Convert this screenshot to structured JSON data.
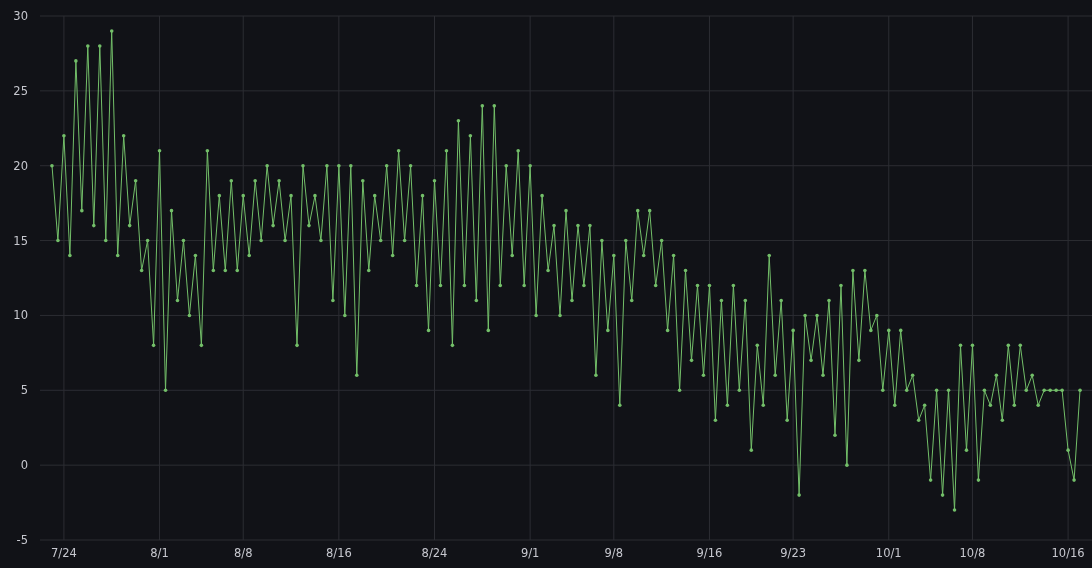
{
  "chart_data": {
    "type": "line",
    "grid": true,
    "ylim": [
      -5,
      30
    ],
    "yticks": [
      -5,
      0,
      5,
      10,
      15,
      20,
      25,
      30
    ],
    "categories": [
      null,
      null,
      "7/24",
      null,
      null,
      null,
      null,
      null,
      null,
      null,
      null,
      null,
      null,
      null,
      null,
      null,
      null,
      null,
      "8/1",
      null,
      null,
      null,
      null,
      null,
      null,
      null,
      null,
      null,
      null,
      null,
      null,
      null,
      "8/8",
      null,
      null,
      null,
      null,
      null,
      null,
      null,
      null,
      null,
      null,
      null,
      null,
      null,
      null,
      null,
      "8/16",
      null,
      null,
      null,
      null,
      null,
      null,
      null,
      null,
      null,
      null,
      null,
      null,
      null,
      null,
      null,
      "8/24",
      null,
      null,
      null,
      null,
      null,
      null,
      null,
      null,
      null,
      null,
      null,
      null,
      null,
      null,
      null,
      "9/1",
      null,
      null,
      null,
      null,
      null,
      null,
      null,
      null,
      null,
      null,
      null,
      null,
      null,
      "9/8",
      null,
      null,
      null,
      null,
      null,
      null,
      null,
      null,
      null,
      null,
      null,
      null,
      null,
      null,
      null,
      "9/16",
      null,
      null,
      null,
      null,
      null,
      null,
      null,
      null,
      null,
      null,
      null,
      null,
      null,
      "9/23",
      null,
      null,
      null,
      null,
      null,
      null,
      null,
      null,
      null,
      null,
      null,
      null,
      null,
      null,
      null,
      "10/1",
      null,
      null,
      null,
      null,
      null,
      null,
      null,
      null,
      null,
      null,
      null,
      null,
      null,
      "10/8",
      null,
      null,
      null,
      null,
      null,
      null,
      null,
      null,
      null,
      null,
      null,
      null,
      null,
      null,
      null,
      "10/16",
      null,
      null
    ],
    "series": [
      {
        "color": "#73bf69",
        "values": [
          20,
          15,
          22,
          14,
          27,
          17,
          28,
          16,
          28,
          15,
          29,
          14,
          22,
          16,
          19,
          13,
          15,
          8,
          21,
          5,
          17,
          11,
          15,
          10,
          14,
          8,
          21,
          13,
          18,
          13,
          19,
          13,
          18,
          14,
          19,
          15,
          20,
          16,
          19,
          15,
          18,
          8,
          20,
          16,
          18,
          15,
          20,
          11,
          20,
          10,
          20,
          6,
          19,
          13,
          18,
          15,
          20,
          14,
          21,
          15,
          20,
          12,
          18,
          9,
          19,
          12,
          21,
          8,
          23,
          12,
          22,
          11,
          24,
          9,
          24,
          12,
          20,
          14,
          21,
          12,
          20,
          10,
          18,
          13,
          16,
          10,
          17,
          11,
          16,
          12,
          16,
          6,
          15,
          9,
          14,
          4,
          15,
          11,
          17,
          14,
          17,
          12,
          15,
          9,
          14,
          5,
          13,
          7,
          12,
          6,
          12,
          3,
          11,
          4,
          12,
          5,
          11,
          1,
          8,
          4,
          14,
          6,
          11,
          3,
          9,
          -2,
          10,
          7,
          10,
          6,
          11,
          2,
          12,
          0,
          13,
          7,
          13,
          9,
          10,
          5,
          9,
          4,
          9,
          5,
          6,
          3,
          4,
          -1,
          5,
          -2,
          5,
          -3,
          8,
          1,
          8,
          -1,
          5,
          4,
          6,
          3,
          8,
          4,
          8,
          5,
          6,
          4,
          5,
          5,
          5,
          5,
          1,
          -1,
          5
        ]
      }
    ]
  }
}
